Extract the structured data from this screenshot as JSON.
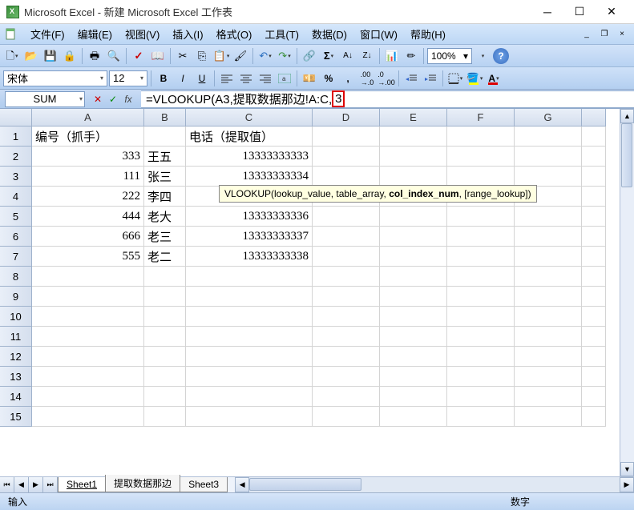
{
  "title": "Microsoft Excel - 新建 Microsoft Excel 工作表",
  "menu": {
    "file": "文件(F)",
    "edit": "编辑(E)",
    "view": "视图(V)",
    "insert": "插入(I)",
    "format": "格式(O)",
    "tools": "工具(T)",
    "data": "数据(D)",
    "window": "窗口(W)",
    "help": "帮助(H)"
  },
  "toolbar": {
    "zoom": "100%"
  },
  "format_bar": {
    "font_name": "宋体",
    "font_size": "12"
  },
  "formula_bar": {
    "name_box": "SUM",
    "formula_prefix": "=VLOOKUP(A3,提取数据那边!A:C,",
    "formula_highlight": "3"
  },
  "tooltip": {
    "fn": "VLOOKUP(",
    "a1": "lookup_value, ",
    "a2": "table_array, ",
    "a3_bold": "col_index_num",
    "a4": ", [range_lookup])"
  },
  "columns": [
    "A",
    "B",
    "C",
    "D",
    "E",
    "F",
    "G"
  ],
  "row_numbers": [
    "1",
    "2",
    "3",
    "4",
    "5",
    "6",
    "7",
    "8",
    "9",
    "10",
    "11",
    "12",
    "13",
    "14",
    "15"
  ],
  "cells": {
    "r1": {
      "a": "编号（抓手）",
      "c": "电话（提取值）"
    },
    "r2": {
      "a": "333",
      "b": "王五",
      "c": "13333333333"
    },
    "r3": {
      "a": "111",
      "b": "张三",
      "c": "13333333334"
    },
    "r4": {
      "a": "222",
      "b": "李四",
      "c": ""
    },
    "r5": {
      "a": "444",
      "b": "老大",
      "c": "13333333336"
    },
    "r6": {
      "a": "666",
      "b": "老三",
      "c": "13333333337"
    },
    "r7": {
      "a": "555",
      "b": "老二",
      "c": "13333333338"
    }
  },
  "sheets": {
    "s1": "Sheet1",
    "s2": "提取数据那边",
    "s3": "Sheet3"
  },
  "status": {
    "left": "输入",
    "right": "数字"
  }
}
